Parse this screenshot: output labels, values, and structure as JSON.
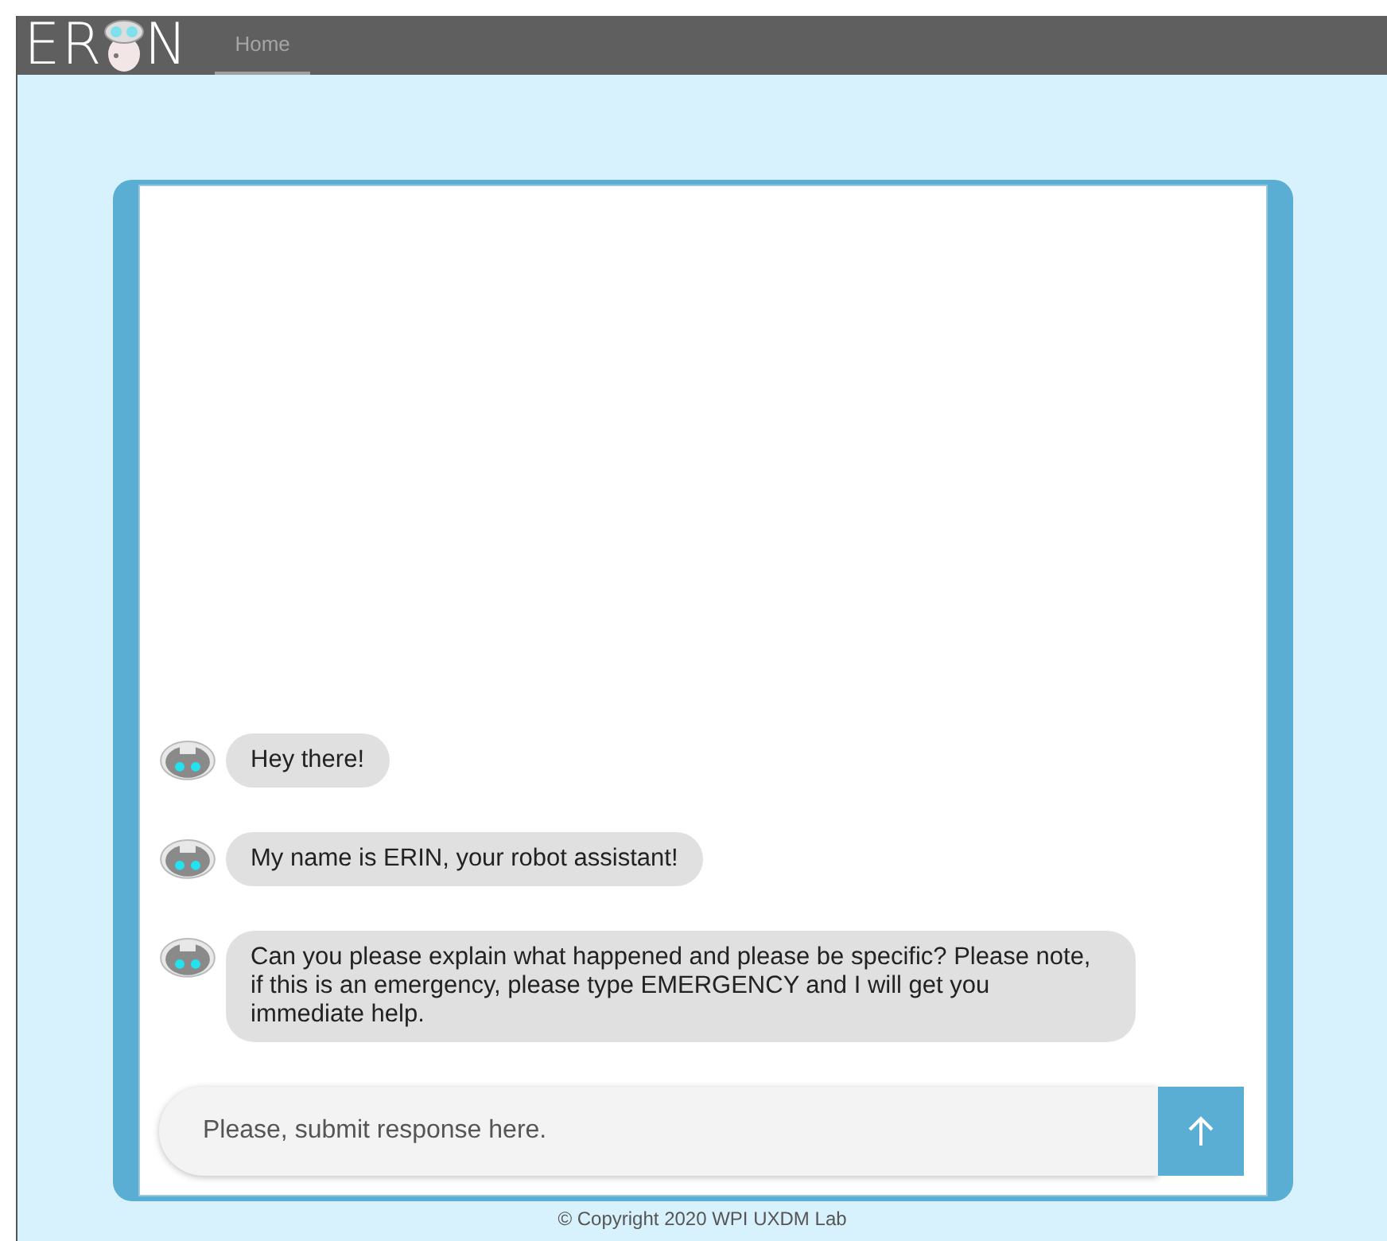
{
  "logo": {
    "before": "ER",
    "after": "N"
  },
  "nav": {
    "tabs": [
      {
        "label": "Home",
        "selected": true
      }
    ]
  },
  "messages": [
    {
      "text": "Hey there!"
    },
    {
      "text": "My name is ERIN, your robot assistant!"
    },
    {
      "text": "Can you please explain what happened and please be specific? Please note, if this is an emergency, please type EMERGENCY and I will get you immediate help."
    }
  ],
  "composer": {
    "placeholder": "Please, submit response here."
  },
  "footer": {
    "copyright": "© Copyright 2020 WPI UXDM Lab"
  }
}
